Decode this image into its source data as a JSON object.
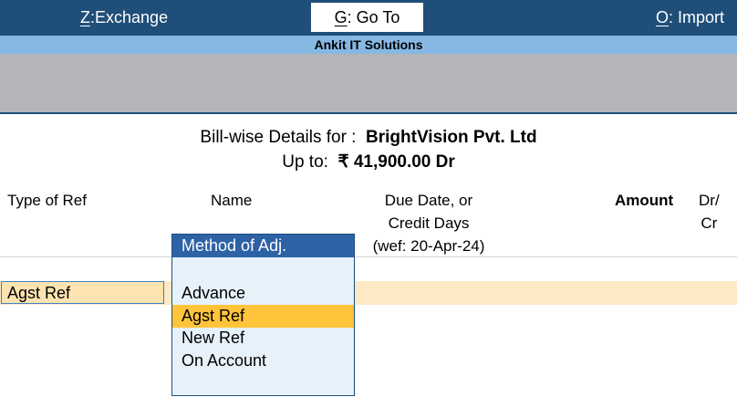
{
  "topbar": {
    "exchange": {
      "key": "Z",
      "label": "Exchange"
    },
    "goto": {
      "key": "G",
      "label": "Go To"
    },
    "import": {
      "key": "O",
      "label": "Import"
    }
  },
  "company": "Ankit IT Solutions",
  "header": {
    "bill_wise_label": "Bill-wise Details for :",
    "party": "BrightVision Pvt. Ltd",
    "upto_label": "Up to:",
    "upto_amount": "₹ 41,900.00 Dr"
  },
  "columns": {
    "type_of_ref": "Type of Ref",
    "name": "Name",
    "due_line1": "Due Date, or",
    "due_line2": "Credit Days",
    "due_line3": "(wef: 20-Apr-24)",
    "amount": "Amount",
    "drcr_line1": "Dr/",
    "drcr_line2": "Cr"
  },
  "row": {
    "type_of_ref": "Agst Ref"
  },
  "popup": {
    "title": "Method of Adj.",
    "items": [
      "Advance",
      "Agst Ref",
      "New Ref",
      "On Account"
    ],
    "selected": "Agst Ref"
  },
  "colors": {
    "nav_bg": "#1f4e79",
    "company_bar": "#86b8e3",
    "popup_title": "#2e62a6",
    "selection": "#ffc43a",
    "row_highlight": "#fde9c4"
  }
}
